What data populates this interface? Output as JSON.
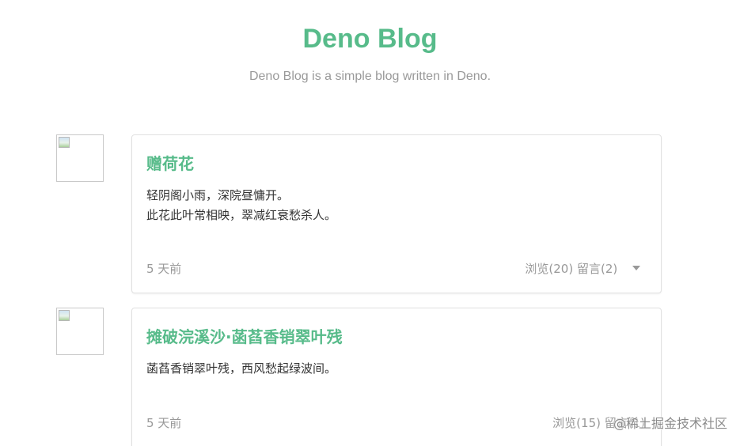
{
  "header": {
    "title": "Deno Blog",
    "subtitle": "Deno Blog is a simple blog written in Deno."
  },
  "posts": [
    {
      "title": "赠荷花",
      "lines": [
        "轻阴阁小雨，深院昼慵开。",
        "此花此叶常相映，翠减红衰愁杀人。"
      ],
      "time": "5 天前",
      "views": "浏览(20)",
      "comments": "留言(2)"
    },
    {
      "title": "摊破浣溪沙·菡萏香销翠叶残",
      "lines": [
        "菡萏香销翠叶残，西风愁起绿波间。"
      ],
      "time": "5 天前",
      "views": "浏览(15)",
      "comments": "留言(1)"
    }
  ],
  "watermark": "@稀土掘金技术社区",
  "colors": {
    "accent": "#57bb8a",
    "muted": "#999999",
    "text": "#333333"
  }
}
